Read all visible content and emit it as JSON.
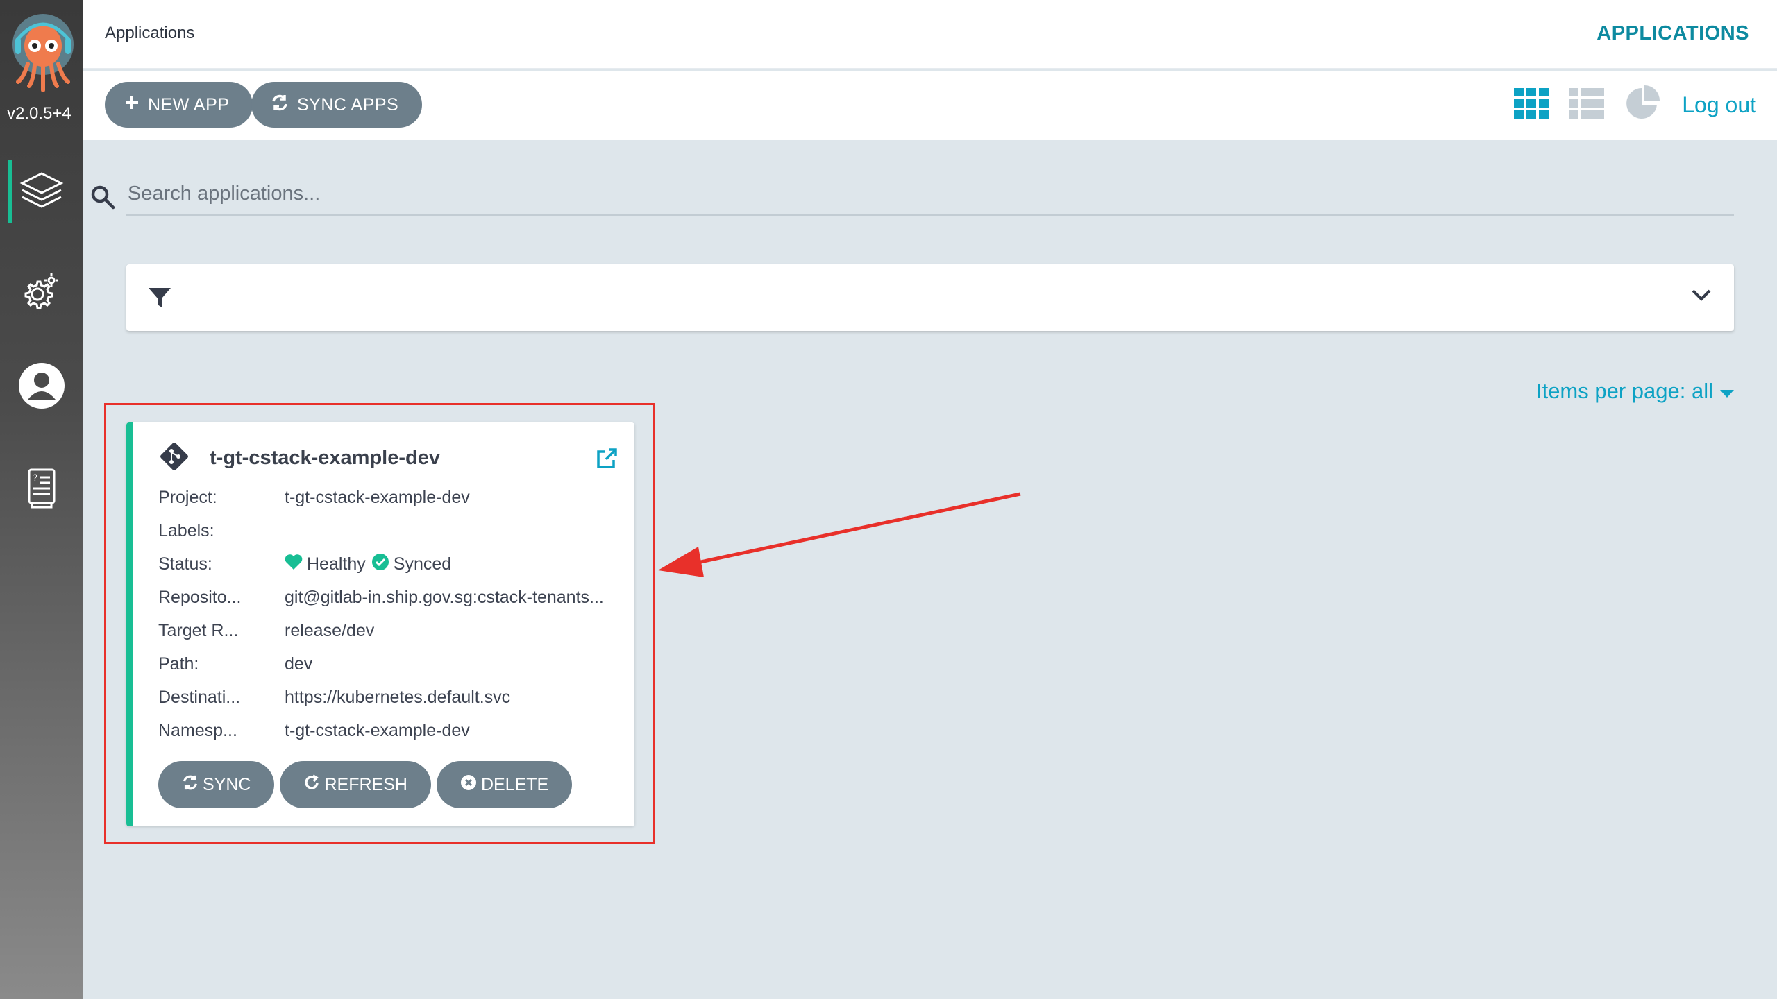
{
  "sidebar": {
    "version": "v2.0.5+4",
    "items": [
      {
        "name": "applications",
        "icon": "layers-icon",
        "active": true
      },
      {
        "name": "settings",
        "icon": "gear-icon",
        "active": false
      },
      {
        "name": "user-info",
        "icon": "user-icon",
        "active": false
      },
      {
        "name": "docs",
        "icon": "docs-icon",
        "active": false
      }
    ]
  },
  "header": {
    "breadcrumb": "Applications",
    "title": "APPLICATIONS"
  },
  "toolbar": {
    "new_app": "NEW APP",
    "sync_apps": "SYNC APPS",
    "view_tiles_icon": "grid-icon",
    "view_list_icon": "list-icon",
    "view_summary_icon": "pie-chart-icon",
    "logout": "Log out"
  },
  "search": {
    "placeholder": "Search applications..."
  },
  "pagination": {
    "items_per_page": "Items per page: all"
  },
  "app_card": {
    "name": "t-gt-cstack-example-dev",
    "fields": [
      {
        "label": "Project:",
        "value": "t-gt-cstack-example-dev"
      },
      {
        "label": "Labels:",
        "value": ""
      },
      {
        "label": "Status:",
        "value": ""
      },
      {
        "label": "Reposito...",
        "value": "git@gitlab-in.ship.gov.sg:cstack-tenants..."
      },
      {
        "label": "Target R...",
        "value": "release/dev"
      },
      {
        "label": "Path:",
        "value": "dev"
      },
      {
        "label": "Destinati...",
        "value": "https://kubernetes.default.svc"
      },
      {
        "label": "Namesp...",
        "value": "t-gt-cstack-example-dev"
      }
    ],
    "health": "Healthy",
    "sync_status": "Synced",
    "actions": {
      "sync": "SYNC",
      "refresh": "REFRESH",
      "delete": "DELETE"
    }
  },
  "colors": {
    "accent": "#0da2c4",
    "healthy": "#18be94",
    "button": "#6d7f8b",
    "annotation": "#e8302a"
  }
}
